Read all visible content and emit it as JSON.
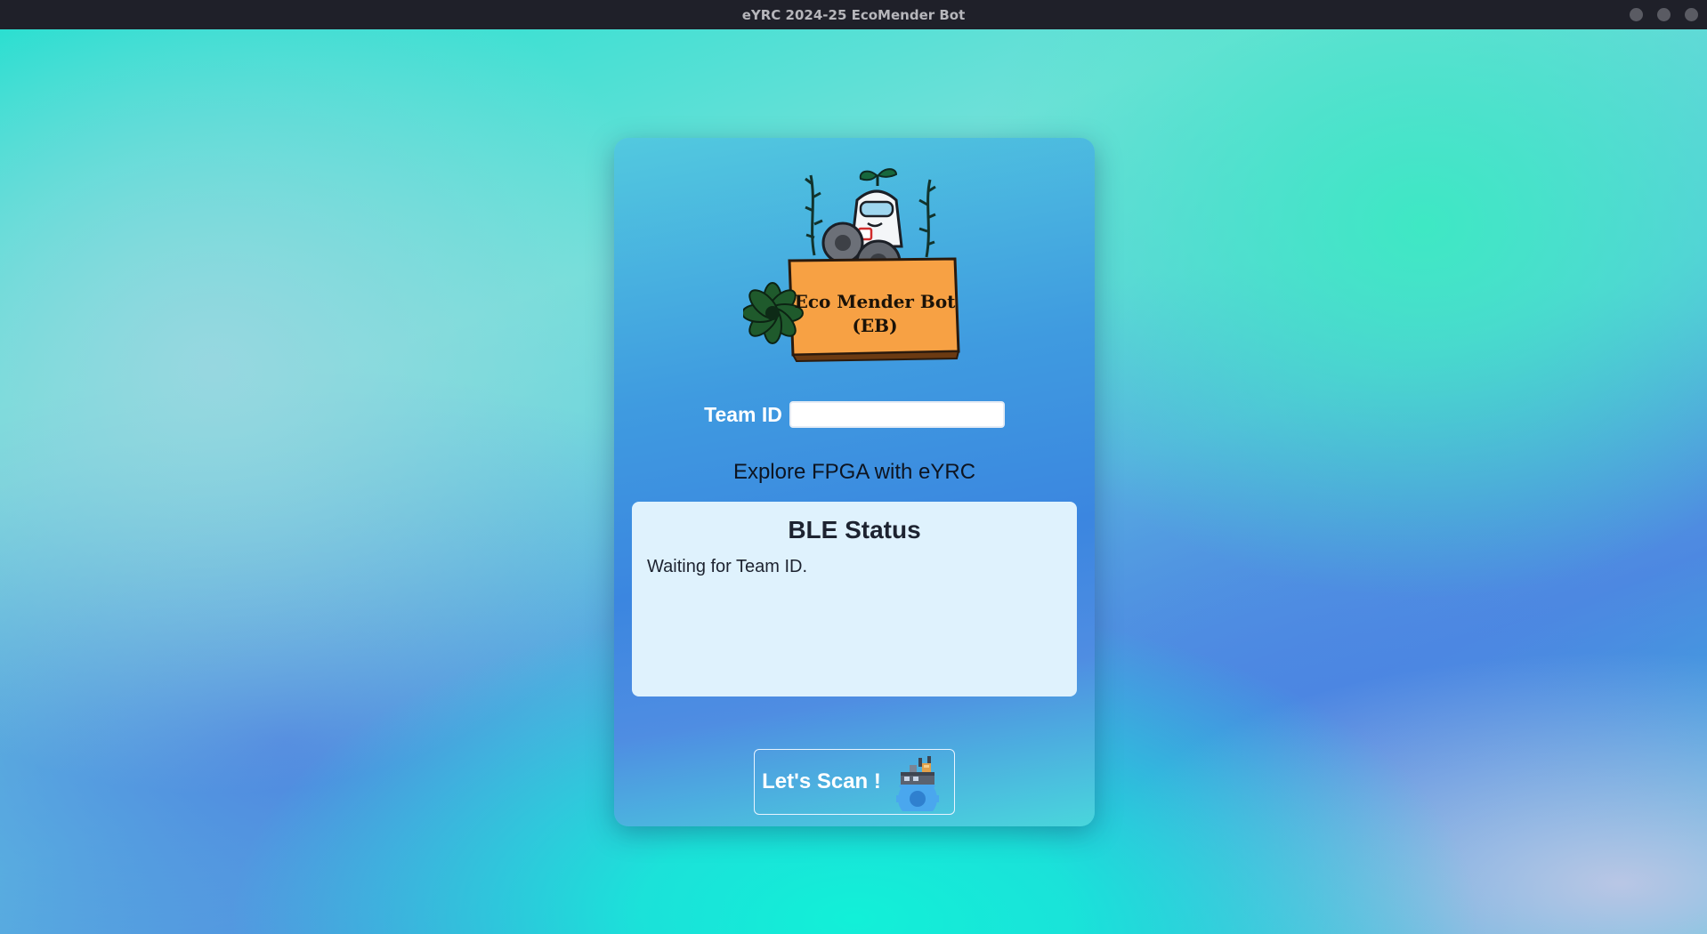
{
  "window": {
    "title": "eYRC 2024-25 EcoMender Bot"
  },
  "logo": {
    "line1": "Eco Mender Bot",
    "line2": "(EB)"
  },
  "team": {
    "label": "Team ID",
    "value": ""
  },
  "tagline": "Explore FPGA with eYRC",
  "ble": {
    "title": "BLE Status",
    "message": "Waiting for Team ID."
  },
  "scan": {
    "label": "Let's Scan !",
    "icon": "gear-factory-icon"
  },
  "colors": {
    "card_top": "#52c9df",
    "card_mid": "#3b86e0",
    "panel": "#dff2fd",
    "sign": "#f7a144"
  }
}
